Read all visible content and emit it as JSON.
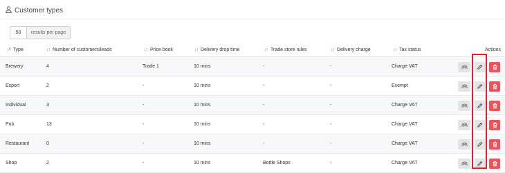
{
  "page": {
    "title": "Customer types"
  },
  "pagination": {
    "per_page": "50",
    "label": "results per page"
  },
  "table": {
    "columns": [
      {
        "key": "type",
        "label": "Type",
        "sort_icon": "sort-ascending-icon"
      },
      {
        "key": "count",
        "label": "Number of customers/leads",
        "sort_icon": "sort-icon"
      },
      {
        "key": "price_book",
        "label": "Price book",
        "sort_icon": "sort-icon"
      },
      {
        "key": "drop_time",
        "label": "Delivery drop time",
        "sort_icon": "sort-icon"
      },
      {
        "key": "trade_rules",
        "label": "Trade store rules",
        "sort_icon": "sort-icon"
      },
      {
        "key": "delivery_charge",
        "label": "Delivery charge",
        "sort_icon": "sort-icon"
      },
      {
        "key": "tax_status",
        "label": "Tax status",
        "sort_icon": "sort-icon"
      }
    ],
    "actions_label": "Actions",
    "rows": [
      {
        "type": "Brewery",
        "count": "4",
        "price_book": "Trade 1",
        "drop_time": "10 mins",
        "trade_rules": "-",
        "delivery_charge": "-",
        "tax_status": "Charge VAT"
      },
      {
        "type": "Export",
        "count": "2",
        "price_book": "-",
        "drop_time": "10 mins",
        "trade_rules": "-",
        "delivery_charge": "-",
        "tax_status": "Exempt"
      },
      {
        "type": "Individual",
        "count": "3",
        "price_book": "-",
        "drop_time": "10 mins",
        "trade_rules": "-",
        "delivery_charge": "-",
        "tax_status": "Charge VAT"
      },
      {
        "type": "Pub",
        "count": "13",
        "price_book": "-",
        "drop_time": "10 mins",
        "trade_rules": "-",
        "delivery_charge": "-",
        "tax_status": "Charge VAT"
      },
      {
        "type": "Restaurant",
        "count": "0",
        "price_book": "-",
        "drop_time": "10 mins",
        "trade_rules": "-",
        "delivery_charge": "-",
        "tax_status": "Charge VAT"
      },
      {
        "type": "Shop",
        "count": "2",
        "price_book": "-",
        "drop_time": "10 mins",
        "trade_rules": "Bottle Shops",
        "delivery_charge": "-",
        "tax_status": "Charge VAT"
      }
    ],
    "row_actions": [
      {
        "name": "view-users",
        "icon": "users-icon"
      },
      {
        "name": "edit",
        "icon": "pencil-icon"
      },
      {
        "name": "delete",
        "icon": "trash-icon"
      }
    ]
  },
  "colors": {
    "delete_button": "#f0525a",
    "neutral_button": "#e3e4e7",
    "highlight": "#e0202a",
    "row_stripe": "#f7f8fa"
  }
}
